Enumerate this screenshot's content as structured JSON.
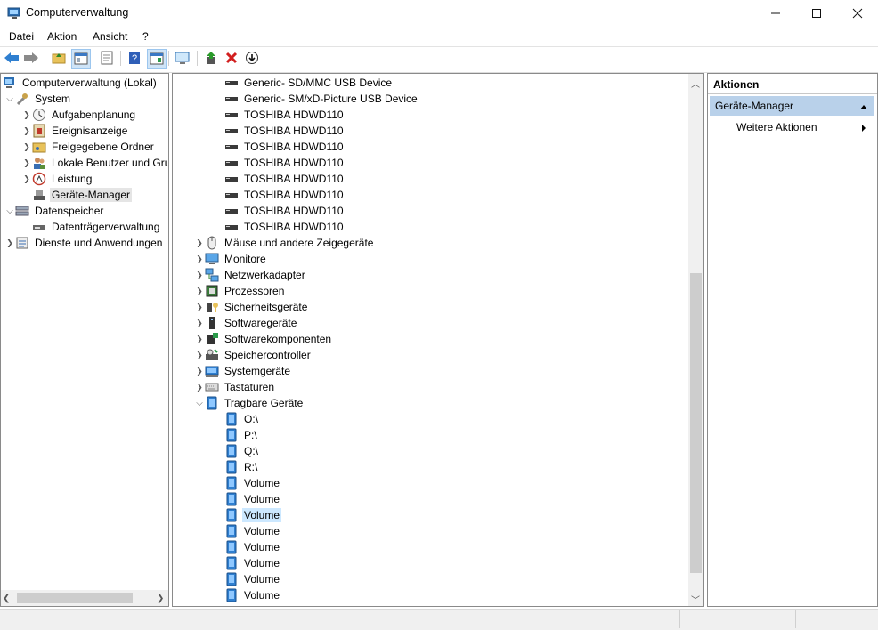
{
  "window": {
    "title": "Computerverwaltung"
  },
  "menu": [
    "Datei",
    "Aktion",
    "Ansicht",
    "?"
  ],
  "tree": {
    "root": "Computerverwaltung (Lokal)",
    "system": "System",
    "system_items": [
      "Aufgabenplanung",
      "Ereignisanzeige",
      "Freigegebene Ordner",
      "Lokale Benutzer und Gru",
      "Leistung",
      "Geräte-Manager"
    ],
    "storage": "Datenspeicher",
    "storage_items": [
      "Datenträgerverwaltung"
    ],
    "services": "Dienste und Anwendungen"
  },
  "devices": {
    "disk_items": [
      "Generic- SD/MMC USB Device",
      "Generic- SM/xD-Picture USB Device",
      "TOSHIBA HDWD110",
      "TOSHIBA HDWD110",
      "TOSHIBA HDWD110",
      "TOSHIBA HDWD110",
      "TOSHIBA HDWD110",
      "TOSHIBA HDWD110",
      "TOSHIBA HDWD110",
      "TOSHIBA HDWD110"
    ],
    "categories": [
      "Mäuse und andere Zeigegeräte",
      "Monitore",
      "Netzwerkadapter",
      "Prozessoren",
      "Sicherheitsgeräte",
      "Softwaregeräte",
      "Softwarekomponenten",
      "Speichercontroller",
      "Systemgeräte",
      "Tastaturen"
    ],
    "portable_category": "Tragbare Geräte",
    "portable_items": [
      "O:\\",
      "P:\\",
      "Q:\\",
      "R:\\",
      "Volume",
      "Volume",
      "Volume",
      "Volume",
      "Volume",
      "Volume",
      "Volume",
      "Volume"
    ],
    "selected_portable_index": 6
  },
  "actions": {
    "header": "Aktionen",
    "section": "Geräte-Manager",
    "more": "Weitere Aktionen"
  },
  "colors": {
    "selection": "#cce8ff",
    "section_bg": "#b9d1ea"
  }
}
